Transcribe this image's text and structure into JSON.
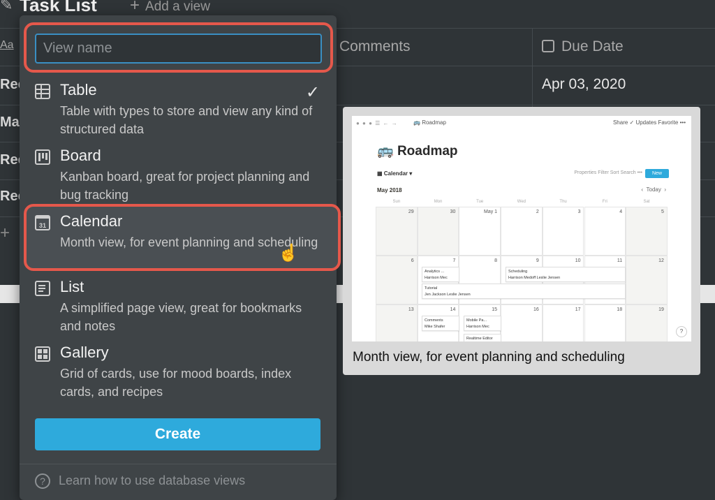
{
  "background": {
    "title": "Task List",
    "add_view": "Add a view",
    "columns": {
      "name_icon": "Aa",
      "comments": "Comments",
      "due_date": "Due Date"
    },
    "first_row_due": "Apr 03, 2020",
    "row_prefixes": [
      "Rec",
      "Ma",
      "Rec",
      "Rec"
    ]
  },
  "menu": {
    "name_placeholder": "View name",
    "items": [
      {
        "id": "table",
        "label": "Table",
        "desc": "Table with types to store and view any kind of structured data",
        "icon": "table-icon",
        "selected": true
      },
      {
        "id": "board",
        "label": "Board",
        "desc": "Kanban board, great for project planning and bug tracking",
        "icon": "board-icon"
      },
      {
        "id": "calendar",
        "label": "Calendar",
        "desc": "Month view, for event planning and scheduling",
        "icon": "calendar-icon",
        "calendar_day": "31"
      },
      {
        "id": "list",
        "label": "List",
        "desc": "A simplified page view, great for bookmarks and notes",
        "icon": "list-icon"
      },
      {
        "id": "gallery",
        "label": "Gallery",
        "desc": "Grid of cards, use for mood boards, index cards, and recipes",
        "icon": "gallery-icon"
      }
    ],
    "create_label": "Create",
    "learn_label": "Learn how to use database views"
  },
  "preview": {
    "caption": "Month view, for event planning and scheduling",
    "screenshot": {
      "crumb": "Roadmap",
      "topright": "Share  ✓ Updates  Favorite  •••",
      "title": "Roadmap",
      "view": "Calendar",
      "toolbar": "Properties   Filter   Sort   Search   •••",
      "new_label": "New",
      "month": "May 2018",
      "today": "Today",
      "days": [
        "Sun",
        "Mon",
        "Tue",
        "Wed",
        "Thu",
        "Fri",
        "Sat"
      ],
      "weeks": [
        [
          "29",
          "30",
          "May 1",
          "2",
          "3",
          "4",
          "5"
        ],
        [
          "6",
          "7",
          "8",
          "9",
          "10",
          "11",
          "12"
        ],
        [
          "13",
          "14",
          "15",
          "16",
          "17",
          "18",
          "19"
        ]
      ],
      "events": {
        "analytics": "Analytics ...",
        "analytics_person": "Harrison Mec",
        "scheduling": "Scheduling",
        "scheduling_people": "Harrison Medoff   Leslie Jensen",
        "tutorial": "Tutorial",
        "tutorial_people": "Jen Jackson   Leslie Jensen",
        "comments": "Comments",
        "comments_person": "Mike Shafer",
        "mobile": "Mobile Pa...",
        "mobile_person": "Harrison Mec",
        "realtime": "Realtime Editor"
      },
      "help": "?"
    }
  },
  "colors": {
    "accent": "#2eaadc",
    "highlight": "#e5584b",
    "menu_bg": "#3f4447",
    "page_bg": "#2f3437"
  }
}
